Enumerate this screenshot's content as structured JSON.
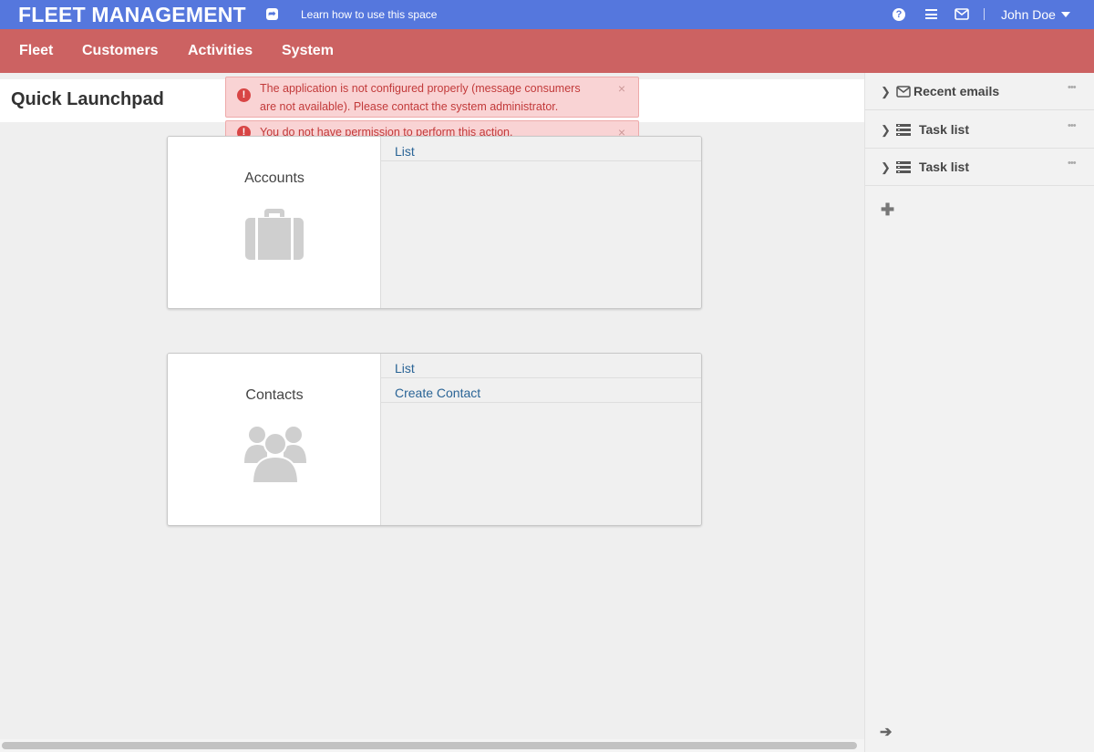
{
  "header": {
    "brand": "FLEET MANAGEMENT",
    "learn_link": "Learn how to use this space",
    "user_name": "John Doe",
    "icons": [
      "share-icon",
      "help-icon",
      "menu-icon",
      "mail-icon",
      "caret-down-icon"
    ]
  },
  "nav": {
    "items": [
      {
        "label": "Fleet"
      },
      {
        "label": "Customers"
      },
      {
        "label": "Activities"
      },
      {
        "label": "System"
      }
    ]
  },
  "page": {
    "title": "Quick Launchpad"
  },
  "alerts": [
    {
      "line1": "The application is not configured properly (message consumers",
      "line2": "are not available). Please contact the system administrator.",
      "close": "×"
    },
    {
      "line1": "You do not have permission to perform this action.",
      "close": "×"
    }
  ],
  "cards": [
    {
      "title": "Accounts",
      "icon": "briefcase-icon",
      "links": [
        {
          "label": "List"
        }
      ]
    },
    {
      "title": "Contacts",
      "icon": "users-icon",
      "links": [
        {
          "label": "List"
        },
        {
          "label": "Create Contact"
        }
      ]
    }
  ],
  "sidebar": {
    "widgets": [
      {
        "label": "Recent emails",
        "icon": "envelope-icon"
      },
      {
        "label": "Task list",
        "icon": "tasks-icon"
      },
      {
        "label": "Task list",
        "icon": "tasks-icon"
      }
    ],
    "more_glyph": "•••",
    "add_glyph": "✚",
    "collapse_glyph": "➔",
    "chevron_glyph": "❯"
  }
}
